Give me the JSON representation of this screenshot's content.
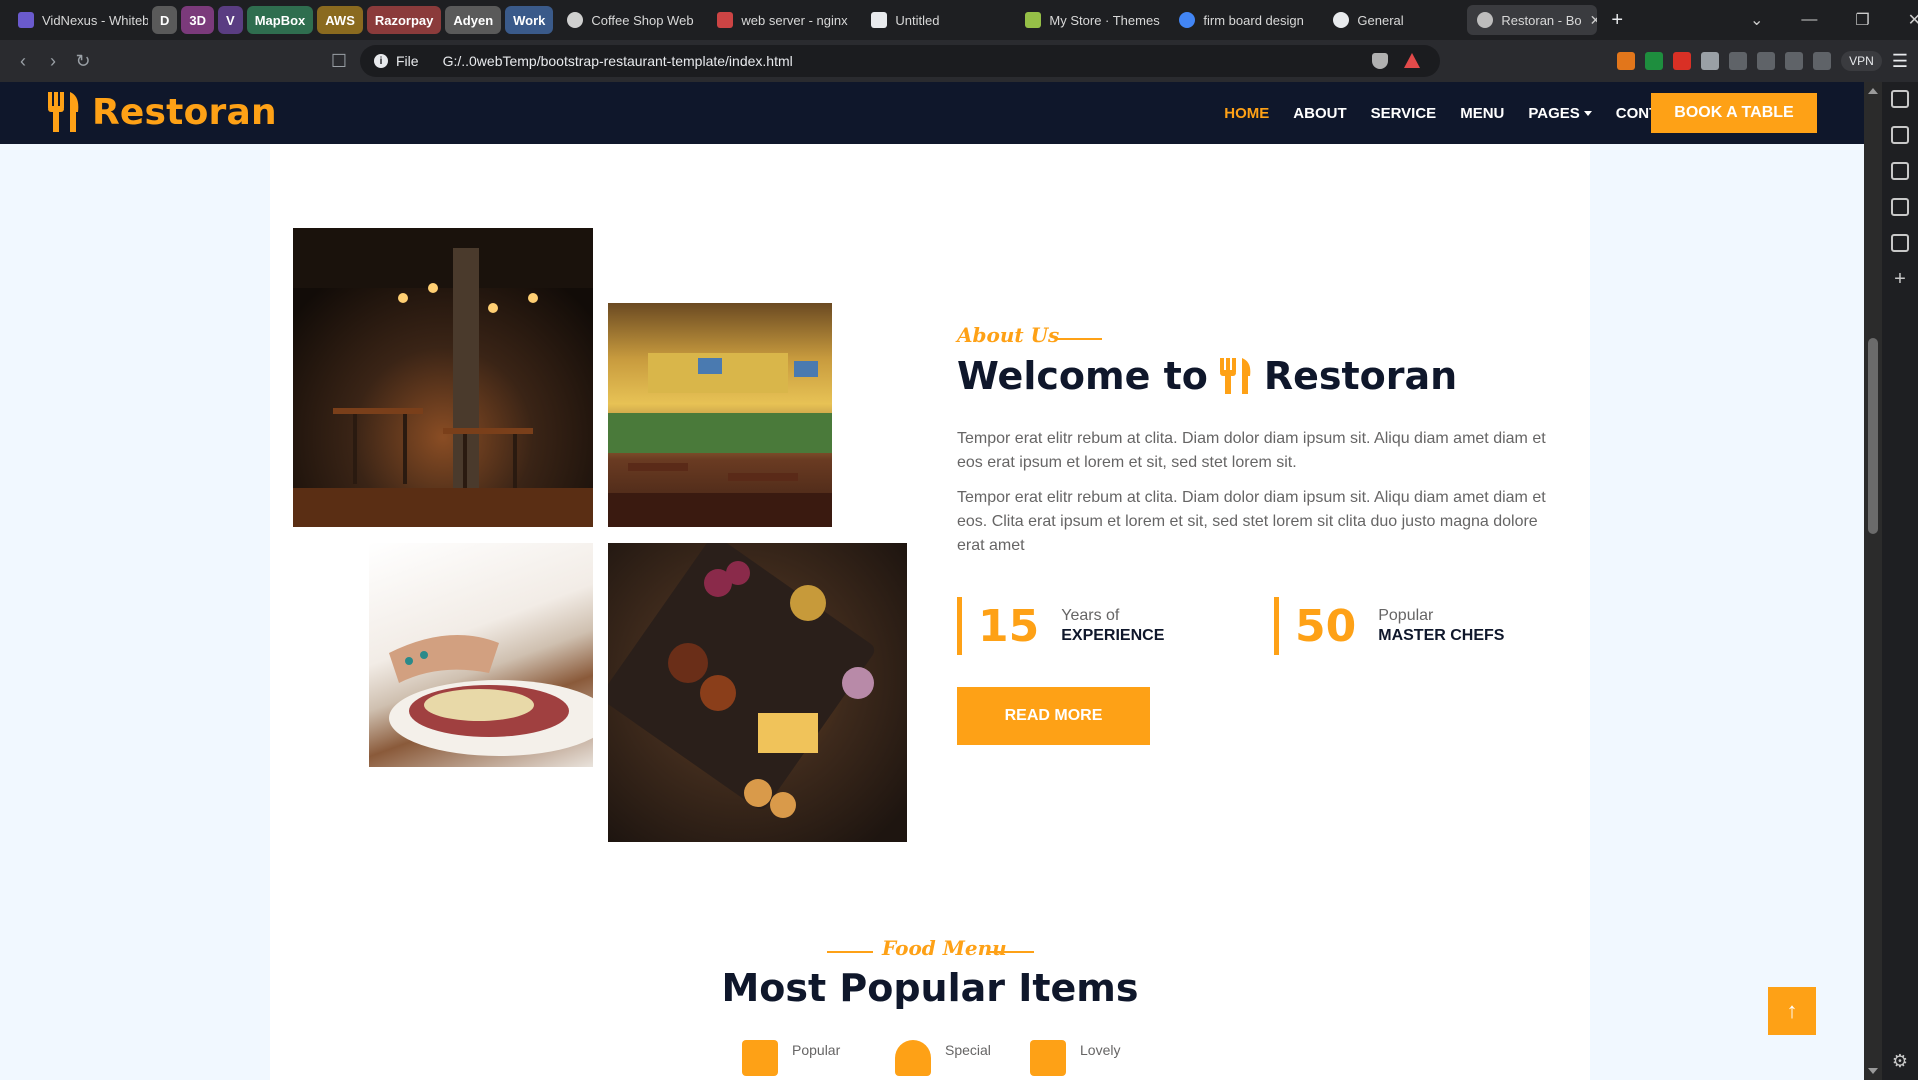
{
  "browser": {
    "tabs": [
      {
        "label": "VidNexus - Whiteb",
        "icon": "vidnexus-icon",
        "color": "#6a5acd"
      },
      {
        "label": "D",
        "group": true,
        "color": "#5a5a5a"
      },
      {
        "label": "3D",
        "group": true,
        "color": "#7b3a7b"
      },
      {
        "label": "V",
        "group": true,
        "color": "#5a3d82"
      },
      {
        "label": "MapBox",
        "group": true,
        "color": "#2f6e4f"
      },
      {
        "label": "AWS",
        "group": true,
        "color": "#8a6a1f"
      },
      {
        "label": "Razorpay",
        "group": true,
        "color": "#8b3b3b"
      },
      {
        "label": "Adyen",
        "group": true,
        "color": "#5a5a5a"
      },
      {
        "label": "Work",
        "group": true,
        "color": "#3a5a8a"
      },
      {
        "label": "Coffee Shop Web",
        "icon": "openai-icon",
        "color": "#cfcfcf"
      },
      {
        "label": "web server - nginx",
        "icon": "flag-icon",
        "color": "#c44"
      },
      {
        "label": "Untitled",
        "icon": "codepen-icon",
        "color": "#e8eaed"
      },
      {
        "label": "My Store · Themes",
        "icon": "shopify-icon",
        "color": "#95bf47"
      },
      {
        "label": "firm board design",
        "icon": "google-icon",
        "color": "#4285f4"
      },
      {
        "label": "General",
        "icon": "github-icon",
        "color": "#e8eaed"
      },
      {
        "label": "Restoran - Bo",
        "icon": "globe-icon",
        "color": "#bdbdbd",
        "active": true
      }
    ],
    "new_tab": "+",
    "url_scheme": "File",
    "url": "G:/..0webTemp/bootstrap-restaurant-template/index.html",
    "vpn": "VPN"
  },
  "site": {
    "brand": "Restoran",
    "nav": [
      "HOME",
      "ABOUT",
      "SERVICE",
      "MENU",
      "PAGES",
      "CONTACT"
    ],
    "active_nav": "HOME",
    "book_button": "BOOK A TABLE",
    "accent": "#fea116",
    "dark": "#0f172b"
  },
  "about": {
    "tag": "About Us",
    "heading_prefix": "Welcome to",
    "heading_brand": "Restoran",
    "para1": "Tempor erat elitr rebum at clita. Diam dolor diam ipsum sit. Aliqu diam amet diam et eos erat ipsum et lorem et sit, sed stet lorem sit.",
    "para2": "Tempor erat elitr rebum at clita. Diam dolor diam ipsum sit. Aliqu diam amet diam et eos. Clita erat ipsum et lorem et sit, sed stet lorem sit clita duo justo magna dolore erat amet",
    "stats": [
      {
        "number": "15",
        "line1": "Years of",
        "line2": "EXPERIENCE"
      },
      {
        "number": "50",
        "line1": "Popular",
        "line2": "MASTER CHEFS"
      }
    ],
    "read_more": "READ MORE"
  },
  "food_menu": {
    "tag": "Food Menu",
    "heading": "Most Popular Items",
    "tabs": [
      "Popular",
      "Special",
      "Lovely"
    ]
  },
  "back_to_top": "↑"
}
